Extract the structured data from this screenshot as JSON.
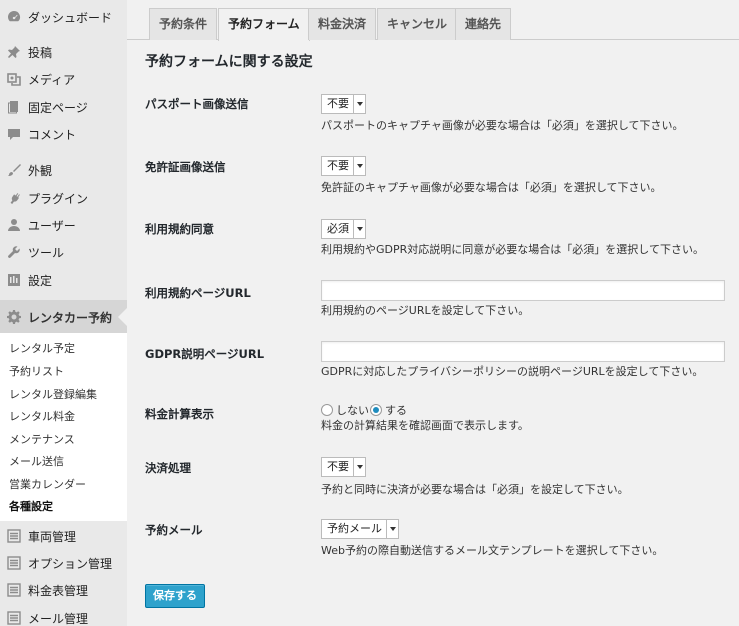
{
  "sidebar": {
    "items": [
      {
        "label": "ダッシュボード",
        "icon": "dashboard-icon"
      },
      {
        "label": "投稿",
        "icon": "pin-icon"
      },
      {
        "label": "メディア",
        "icon": "media-icon"
      },
      {
        "label": "固定ページ",
        "icon": "page-icon"
      },
      {
        "label": "コメント",
        "icon": "comment-icon"
      },
      {
        "label": "外観",
        "icon": "brush-icon"
      },
      {
        "label": "プラグイン",
        "icon": "plugin-icon"
      },
      {
        "label": "ユーザー",
        "icon": "user-icon"
      },
      {
        "label": "ツール",
        "icon": "wrench-icon"
      },
      {
        "label": "設定",
        "icon": "settings-icon"
      }
    ],
    "current": {
      "label": "レンタカー予約",
      "icon": "gear-icon"
    },
    "submenu": [
      "レンタル予定",
      "予約リスト",
      "レンタル登録編集",
      "レンタル料金",
      "メンテナンス",
      "メール送信",
      "営業カレンダー",
      "各種設定"
    ],
    "bottom_items": [
      {
        "label": "車両管理",
        "icon": "list-icon"
      },
      {
        "label": "オプション管理",
        "icon": "list-icon"
      },
      {
        "label": "料金表管理",
        "icon": "list-icon"
      },
      {
        "label": "メール管理",
        "icon": "list-icon"
      }
    ]
  },
  "tabs": [
    "予約条件",
    "予約フォーム",
    "料金決済",
    "キャンセル",
    "連絡先"
  ],
  "active_tab": "予約フォーム",
  "section_title": "予約フォームに関する設定",
  "settings": {
    "passport": {
      "label": "パスポート画像送信",
      "value": "不要",
      "desc": "パスポートのキャプチャ画像が必要な場合は「必須」を選択して下さい。"
    },
    "license": {
      "label": "免許証画像送信",
      "value": "不要",
      "desc": "免許証のキャプチャ画像が必要な場合は「必須」を選択して下さい。"
    },
    "terms": {
      "label": "利用規約同意",
      "value": "必須",
      "desc": "利用規約やGDPR対応説明に同意が必要な場合は「必須」を選択して下さい。"
    },
    "terms_url": {
      "label": "利用規約ページURL",
      "value": "",
      "desc": "利用規約のページURLを設定して下さい。"
    },
    "gdpr_url": {
      "label": "GDPR説明ページURL",
      "value": "",
      "desc": "GDPRに対応したプライバシーポリシーの説明ページURLを設定して下さい。"
    },
    "price_display": {
      "label": "料金計算表示",
      "options": [
        "しない",
        "する"
      ],
      "selected": "する",
      "desc": "料金の計算結果を確認画面で表示します。"
    },
    "payment": {
      "label": "決済処理",
      "value": "不要",
      "desc": "予約と同時に決済が必要な場合は「必須」を設定して下さい。"
    },
    "mail": {
      "label": "予約メール",
      "value": "予約メール",
      "desc": "Web予約の際自動送信するメール文テンプレートを選択して下さい。"
    }
  },
  "save_label": "保存する",
  "colors": {
    "primary_button": "#2ea2cc",
    "radio_checked": "#1e8cbe",
    "sidebar_bg": "#e9e9e9"
  }
}
